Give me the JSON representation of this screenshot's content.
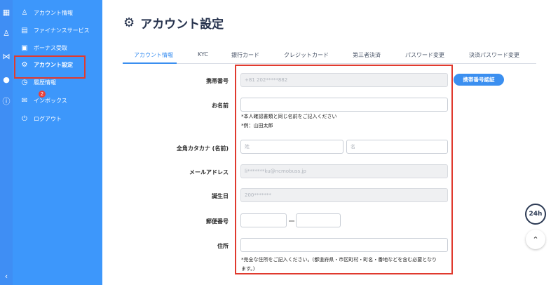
{
  "sidebar": {
    "items": [
      {
        "label": "アカウント情報",
        "icon": "user-icon"
      },
      {
        "label": "ファイナンスサービス",
        "icon": "finance-icon"
      },
      {
        "label": "ボーナス受取",
        "icon": "gift-icon"
      },
      {
        "label": "アカウント設定",
        "icon": "gear-icon"
      },
      {
        "label": "履歴情報",
        "icon": "history-icon"
      },
      {
        "label": "インボックス",
        "icon": "inbox-icon"
      },
      {
        "label": "ログアウト",
        "icon": "logout-icon"
      }
    ],
    "inbox_badge": "2",
    "active_index": 3
  },
  "page": {
    "title": "アカウント設定",
    "tabs": [
      "アカウント情報",
      "KYC",
      "銀行カード",
      "クレジットカード",
      "第三者決済",
      "パスワード変更",
      "決済パスワード変更"
    ]
  },
  "form": {
    "phone_label": "携帯番号",
    "phone_value": "+81 202*****882",
    "verify_button": "携帯番号認証",
    "name_label": "お名前",
    "name_value": "",
    "name_note_1": "*本人確認書類と同じ名前をご記入ください",
    "name_note_2": "*例：山田太郎",
    "kana_label": "全角カタカナ (名前)",
    "kana_sei_placeholder": "姓",
    "kana_mei_placeholder": "名",
    "email_label": "メールアドレス",
    "email_value": "li*******ku@ncmobuss.jp",
    "birth_label": "誕生日",
    "birth_value": "200*******",
    "zip_label": "郵便番号",
    "zip_dash": "ー",
    "address_label": "住所",
    "address_note_1": "*完全な住所をご記入ください。(都道府県・市区町村・町名・番地などを含む必要となり",
    "address_note_2": "ます。)"
  },
  "floating": {
    "chat_label": "24h",
    "scroll_top_icon": "arrow-up-icon"
  },
  "colors": {
    "sidebar": "#3d97fb",
    "accent": "#3b8ff0",
    "highlight": "#e03a2e"
  }
}
